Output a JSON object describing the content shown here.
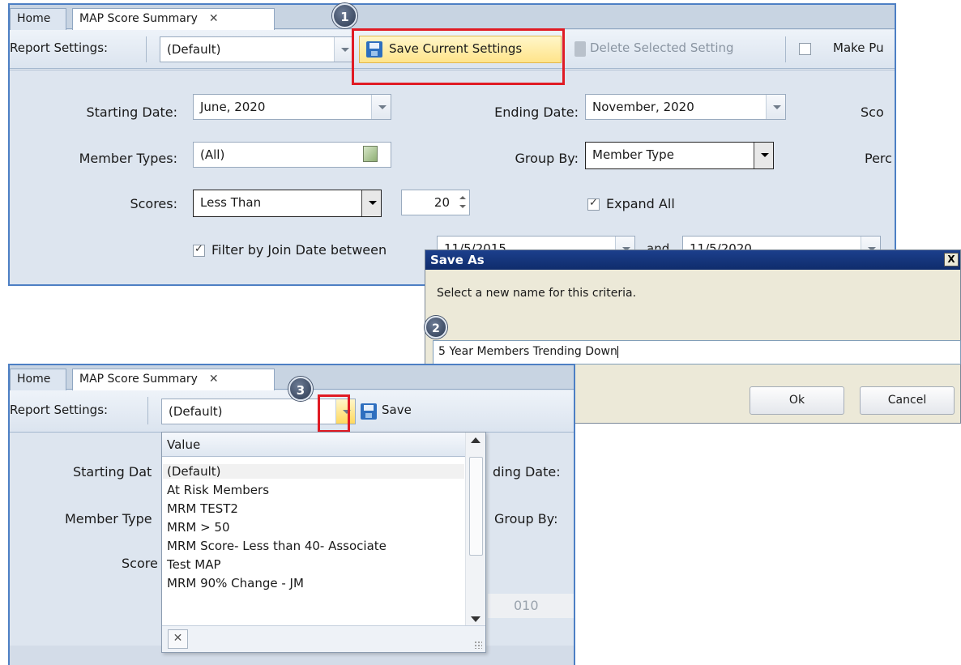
{
  "panel1": {
    "tabs": {
      "home": "Home",
      "active": "MAP Score Summary",
      "close_glyph": "✕"
    },
    "toolbar": {
      "report_settings_label": "Report Settings:",
      "report_settings_value": "(Default)",
      "save_current_settings": "Save Current Settings",
      "delete_selected_setting": "Delete Selected Setting",
      "make_public": "Make Pu"
    },
    "form": {
      "starting_date_label": "Starting Date:",
      "starting_date_value": "June, 2020",
      "ending_date_label": "Ending Date:",
      "ending_date_value": "November, 2020",
      "score_label_partial": "Sco",
      "member_types_label": "Member Types:",
      "member_types_value": "(All)",
      "group_by_label": "Group By:",
      "group_by_value": "Member Type",
      "percent_label_partial": "Perc",
      "scores_label": "Scores:",
      "scores_operator": "Less Than",
      "scores_value": "20",
      "expand_all": "Expand All",
      "expand_all_checked": true,
      "filter_join_date": "Filter by Join Date between",
      "filter_checked": true,
      "join_from": "11/5/2015",
      "join_and": "and",
      "join_to": "11/5/2020"
    },
    "step_badge": "1"
  },
  "dialog": {
    "title": "Save As",
    "close_glyph": "X",
    "prompt": "Select a new name for this criteria.",
    "name_value": "5 Year Members Trending Down",
    "ok": "Ok",
    "cancel": "Cancel",
    "step_badge": "2"
  },
  "panel2": {
    "tabs": {
      "home": "Home",
      "active": "MAP Score Summary",
      "close_glyph": "✕"
    },
    "toolbar": {
      "report_settings_label": "Report Settings:",
      "report_settings_value": "(Default)",
      "save_partial": "Save"
    },
    "behind_labels": {
      "starting_date": "Starting Dat",
      "member_type": "Member Type",
      "score": "Score",
      "ending_date": "ding Date:",
      "group_by": "Group By:",
      "year_partial": "010"
    },
    "step_badge": "3",
    "dropdown": {
      "header": "Value",
      "items": [
        "(Default)",
        "At Risk Members",
        "MRM TEST2",
        "MRM > 50",
        "MRM Score- Less than 40- Associate",
        "Test MAP",
        "MRM 90% Change - JM"
      ],
      "clear_glyph": "✕"
    }
  },
  "colors": {
    "accent_border": "#4d7fc4",
    "highlight_red": "#e01b24",
    "save_button_bg": "#ffe48a",
    "dialog_title_bg": "#1c3f8c"
  }
}
